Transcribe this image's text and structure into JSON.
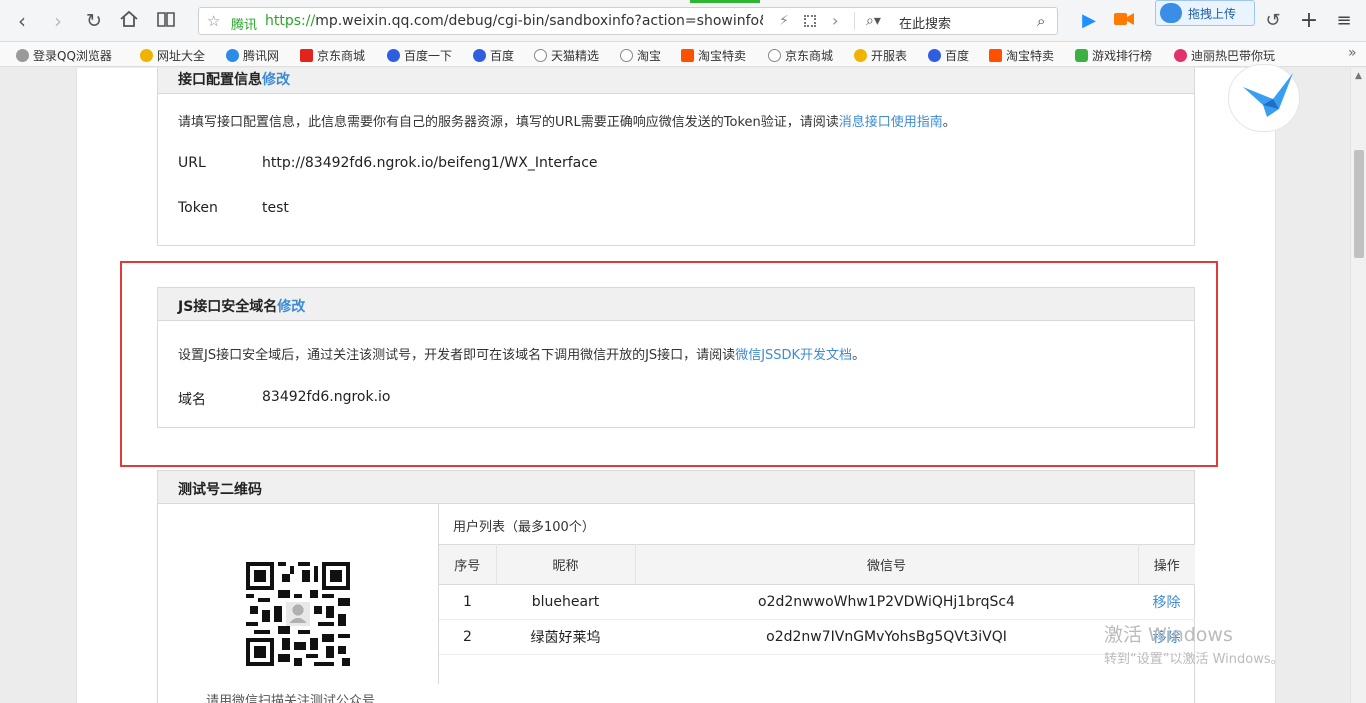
{
  "browser": {
    "site_name": "腾讯",
    "url_scheme": "https://",
    "url_rest": "mp.weixin.qq.com/debug/cgi-bin/sandboxinfo?action=showinfo&t=sand",
    "search_placeholder": "在此搜索",
    "upload_label": "拖拽上传"
  },
  "bookmarks": [
    {
      "label": "登录QQ浏览器",
      "color": "#9a9a9a"
    },
    {
      "label": "网址大全",
      "color": "#f0b400"
    },
    {
      "label": "腾讯网",
      "color": "#2c8ae8"
    },
    {
      "label": "京东商城",
      "color": "#e1251b"
    },
    {
      "label": "百度一下",
      "color": "#2f5ee0"
    },
    {
      "label": "百度",
      "color": "#2f5ee0"
    },
    {
      "label": "天猫精选",
      "color": "#888888"
    },
    {
      "label": "淘宝",
      "color": "#888888"
    },
    {
      "label": "淘宝特卖",
      "color": "#ff5000"
    },
    {
      "label": "京东商城",
      "color": "#888888"
    },
    {
      "label": "开服表",
      "color": "#f0b400"
    },
    {
      "label": "百度",
      "color": "#2f5ee0"
    },
    {
      "label": "淘宝特卖",
      "color": "#ff5000"
    },
    {
      "label": "游戏排行榜",
      "color": "#3cb043"
    },
    {
      "label": "迪丽热巴带你玩",
      "color": "#e0336a"
    }
  ],
  "interface_config": {
    "title": "接口配置信息",
    "edit_label": "修改",
    "description": "请填写接口配置信息，此信息需要你有自己的服务器资源，填写的URL需要正确响应微信发送的Token验证，请阅读",
    "description_link": "消息接口使用指南",
    "description_end": "。",
    "url_label": "URL",
    "url_value": "http://83492fd6.ngrok.io/beifeng1/WX_Interface",
    "token_label": "Token",
    "token_value": "test"
  },
  "js_domain": {
    "title": "JS接口安全域名",
    "edit_label": "修改",
    "description": "设置JS接口安全域后，通过关注该测试号，开发者即可在该域名下调用微信开放的JS接口，请阅读",
    "description_link": "微信JSSDK开发文档",
    "description_end": "。",
    "domain_label": "域名",
    "domain_value": "83492fd6.ngrok.io"
  },
  "qrcode": {
    "title": "测试号二维码",
    "caption": "请用微信扫描关注测试公众号",
    "user_list_title": "用户列表（最多100个）",
    "columns": [
      "序号",
      "昵称",
      "微信号",
      "操作"
    ],
    "rows": [
      {
        "index": "1",
        "nickname": "blueheart",
        "wechat_id": "o2d2nwwoWhw1P2VDWiQHj1brqSc4",
        "action": "移除"
      },
      {
        "index": "2",
        "nickname": "绿茵好莱坞",
        "wechat_id": "o2d2nw7IVnGMvYohsBg5QVt3iVQI",
        "action": "移除"
      }
    ]
  },
  "watermark": {
    "line1": "激活 Windows",
    "line2": "转到“设置”以激活 Windows。"
  }
}
